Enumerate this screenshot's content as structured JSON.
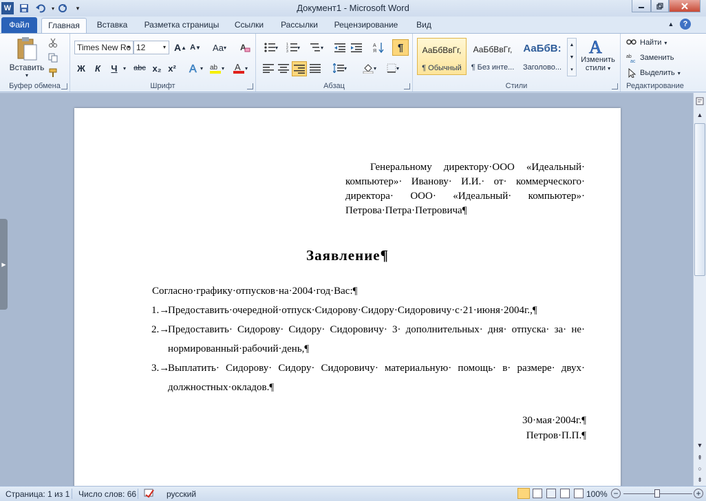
{
  "window": {
    "title": "Документ1 - Microsoft Word",
    "app_icon": "W"
  },
  "tabs": [
    {
      "label": "Файл"
    },
    {
      "label": "Главная"
    },
    {
      "label": "Вставка"
    },
    {
      "label": "Разметка страницы"
    },
    {
      "label": "Ссылки"
    },
    {
      "label": "Рассылки"
    },
    {
      "label": "Рецензирование"
    },
    {
      "label": "Вид"
    }
  ],
  "ribbon": {
    "clipboard": {
      "label": "Буфер обмена",
      "paste_label": "Вставить"
    },
    "font": {
      "label": "Шрифт",
      "font_name": "Times New Ro",
      "font_size": "12",
      "bold": "Ж",
      "italic": "К",
      "underline": "Ч",
      "strike": "abc",
      "sub": "x₂",
      "sup": "x²",
      "grow": "A",
      "shrink": "A",
      "case": "Aa"
    },
    "paragraph": {
      "label": "Абзац",
      "pilcrow": "¶"
    },
    "styles": {
      "label": "Стили",
      "items": [
        {
          "sample": "АаБбВвГг,",
          "name": "¶ Обычный"
        },
        {
          "sample": "АаБбВвГг,",
          "name": "¶ Без инте..."
        },
        {
          "sample": "АаБбВ:",
          "name": "Заголово..."
        }
      ],
      "change_label_1": "Изменить",
      "change_label_2": "стили"
    },
    "editing": {
      "label": "Редактирование",
      "find": "Найти",
      "replace": "Заменить",
      "select": "Выделить"
    }
  },
  "document": {
    "address": [
      "Генеральному директору·ООО «Идеальный·",
      "компьютер»· Иванову· И.И.· от· коммерческого·",
      "директора· ООО· «Идеальный· компьютер»·",
      "Петрова·Петра·Петровича¶"
    ],
    "title": "Заявление¶",
    "intro": "Согласно·графику·отпусков·на·2004·год·Вас:¶",
    "items": [
      {
        "num": "1.→",
        "lines": [
          "Предоставить·очередной·отпуск·Сидорову·Сидору·Сидоровичу·с·21·июня·2004г.,¶"
        ]
      },
      {
        "num": "2.→",
        "lines": [
          "Предоставить· Сидорову· Сидору· Сидоровичу· 3· дополнительных· дня· отпуска· за· не·",
          "нормированный·рабочий·день,¶"
        ]
      },
      {
        "num": "3.→",
        "lines": [
          "Выплатить· Сидорову· Сидору· Сидоровичу· материальную· помощь· в· размере· двух·",
          "должностных·окладов.¶"
        ]
      }
    ],
    "date": "30·мая·2004г.¶",
    "signature": "Петров·П.П.¶"
  },
  "status": {
    "page": "Страница: 1 из 1",
    "words": "Число слов: 66",
    "language": "русский",
    "zoom": "100%"
  }
}
